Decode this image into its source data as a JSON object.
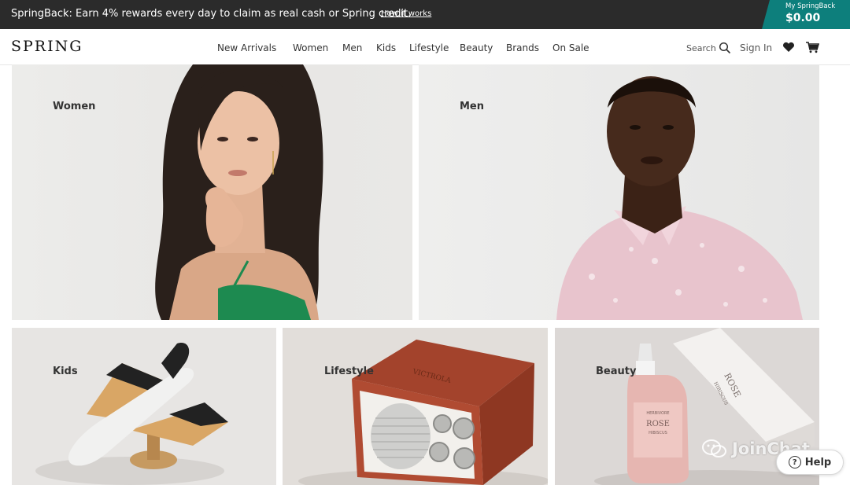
{
  "promo": {
    "text": "SpringBack: Earn 4% rewards every day to claim as real cash or Spring credit.",
    "link": "How it works",
    "springback_label": "My SpringBack",
    "springback_amount": "$0.00"
  },
  "nav": {
    "logo": "SPRING",
    "items": [
      "New Arrivals",
      "Women",
      "Men",
      "Kids",
      "Lifestyle",
      "Beauty",
      "Brands",
      "On Sale"
    ],
    "search": "Search",
    "signin": "Sign In"
  },
  "tiles": {
    "women": "Women",
    "men": "Men",
    "kids": "Kids",
    "lifestyle": "Lifestyle",
    "beauty": "Beauty"
  },
  "product_text": {
    "radio_brand": "VICTROLA",
    "bottle_brand": "HERBIVORE",
    "bottle_name": "ROSE",
    "bottle_sub": "HIBISCUS",
    "box_name": "ROSE",
    "box_sub": "HIBISCUS"
  },
  "watermark": "JoinChat",
  "help": "Help",
  "colors": {
    "promo_bg": "#2b2b2b",
    "springback_bg": "#0d7f7c"
  }
}
